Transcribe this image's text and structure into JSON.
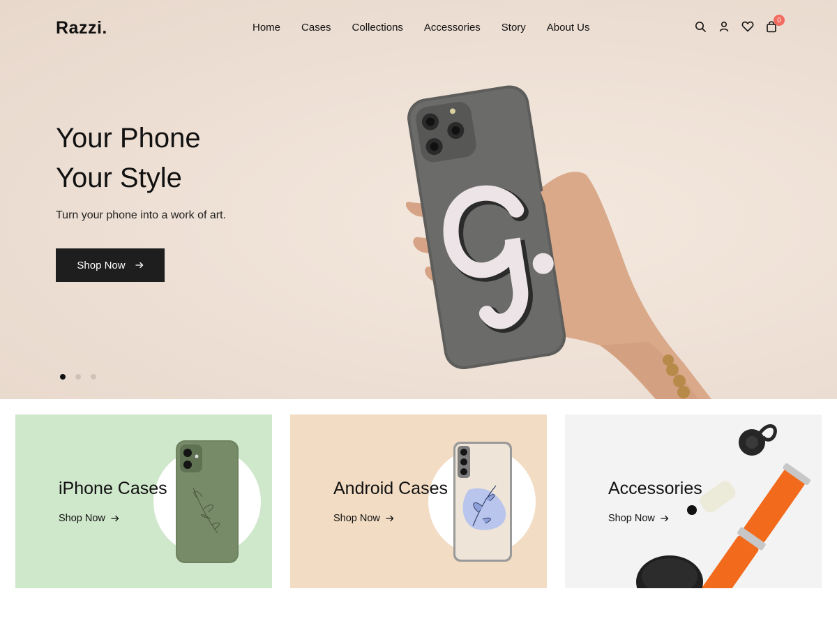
{
  "brand": {
    "logo": "Razzi."
  },
  "nav": {
    "items": [
      "Home",
      "Cases",
      "Collections",
      "Accessories",
      "Story",
      "About Us"
    ]
  },
  "header_icons": {
    "search": "search-icon",
    "account": "user-icon",
    "wishlist": "heart-icon",
    "cart": "bag-icon",
    "cart_count": "0"
  },
  "hero": {
    "title_line1": "Your Phone",
    "title_line2": "Your Style",
    "subtitle": "Turn your phone into a work of art.",
    "cta_label": "Shop Now",
    "slides": 3,
    "active_slide": 1
  },
  "categories": [
    {
      "title": "iPhone Cases",
      "link": "Shop Now"
    },
    {
      "title": "Android Cases",
      "link": "Shop Now"
    },
    {
      "title": "Accessories",
      "link": "Shop Now"
    }
  ],
  "colors": {
    "hero_bg": "#efe2d8",
    "card_iphone": "#cfe7cb",
    "card_android": "#f2dcc4",
    "card_accessories": "#f3f3f3",
    "button_dark": "#1e1e1e",
    "badge": "#f26b60"
  }
}
